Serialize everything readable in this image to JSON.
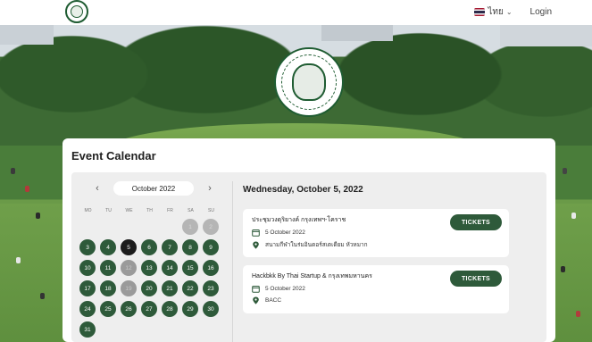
{
  "nav": {
    "language_label": "ไทย",
    "login_label": "Login"
  },
  "calendar": {
    "section_title": "Event Calendar",
    "month_label": "October 2022",
    "weekdays": [
      "MO",
      "TU",
      "WE",
      "TH",
      "FR",
      "SA",
      "SU"
    ],
    "leading_days": [
      "1",
      "2"
    ],
    "days": [
      "3",
      "4",
      "5",
      "6",
      "7",
      "8",
      "9",
      "10",
      "11",
      "12",
      "13",
      "14",
      "15",
      "16",
      "17",
      "18",
      "19",
      "20",
      "21",
      "22",
      "23",
      "24",
      "25",
      "26",
      "27",
      "28",
      "29",
      "30",
      "31"
    ],
    "selected_day": "5"
  },
  "events_panel": {
    "date_heading": "Wednesday, October 5, 2022",
    "events": [
      {
        "title": "ประชุมวงดุริยางค์ กรุงเทพฯ-โคราช",
        "date": "5 October 2022",
        "location": "สนามกีฬาในร่มอินดอร์สเตเดียม หัวหมาก",
        "button_label": "TICKETS"
      },
      {
        "title": "Hackbkk By Thai Startup & กรุงเทพมหานคร",
        "date": "5 October 2022",
        "location": "BACC",
        "button_label": "TICKETS"
      }
    ]
  },
  "colors": {
    "accent": "#2e5a3a",
    "selected_day": "#1c1c1c",
    "panel_bg": "#eeeeee"
  },
  "icons": [
    "bangkok-emblem-icon",
    "thai-flag-icon",
    "chevron-down-icon",
    "chevron-left-icon",
    "chevron-right-icon",
    "calendar-icon",
    "location-pin-icon"
  ]
}
